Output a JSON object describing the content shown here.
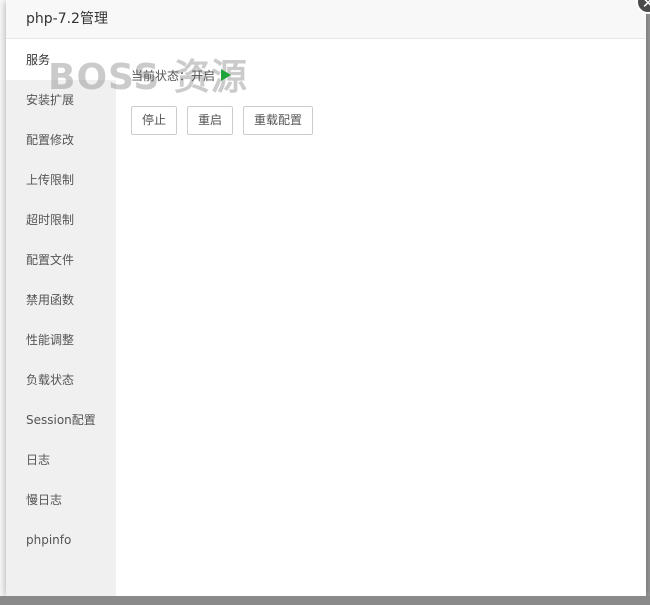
{
  "dialog": {
    "title": "php-7.2管理",
    "close_glyph": "✕"
  },
  "watermark": "BOSS 资源",
  "sidebar": {
    "items": [
      {
        "label": "服务",
        "active": true
      },
      {
        "label": "安装扩展"
      },
      {
        "label": "配置修改"
      },
      {
        "label": "上传限制"
      },
      {
        "label": "超时限制"
      },
      {
        "label": "配置文件"
      },
      {
        "label": "禁用函数"
      },
      {
        "label": "性能调整"
      },
      {
        "label": "负载状态"
      },
      {
        "label": "Session配置"
      },
      {
        "label": "日志"
      },
      {
        "label": "慢日志"
      },
      {
        "label": "phpinfo"
      }
    ]
  },
  "main": {
    "status_label": "当前状态：",
    "status_value": "开启",
    "status_icon": "play-icon",
    "status_color": "#20a53a",
    "buttons": [
      "停止",
      "重启",
      "重载配置"
    ]
  }
}
